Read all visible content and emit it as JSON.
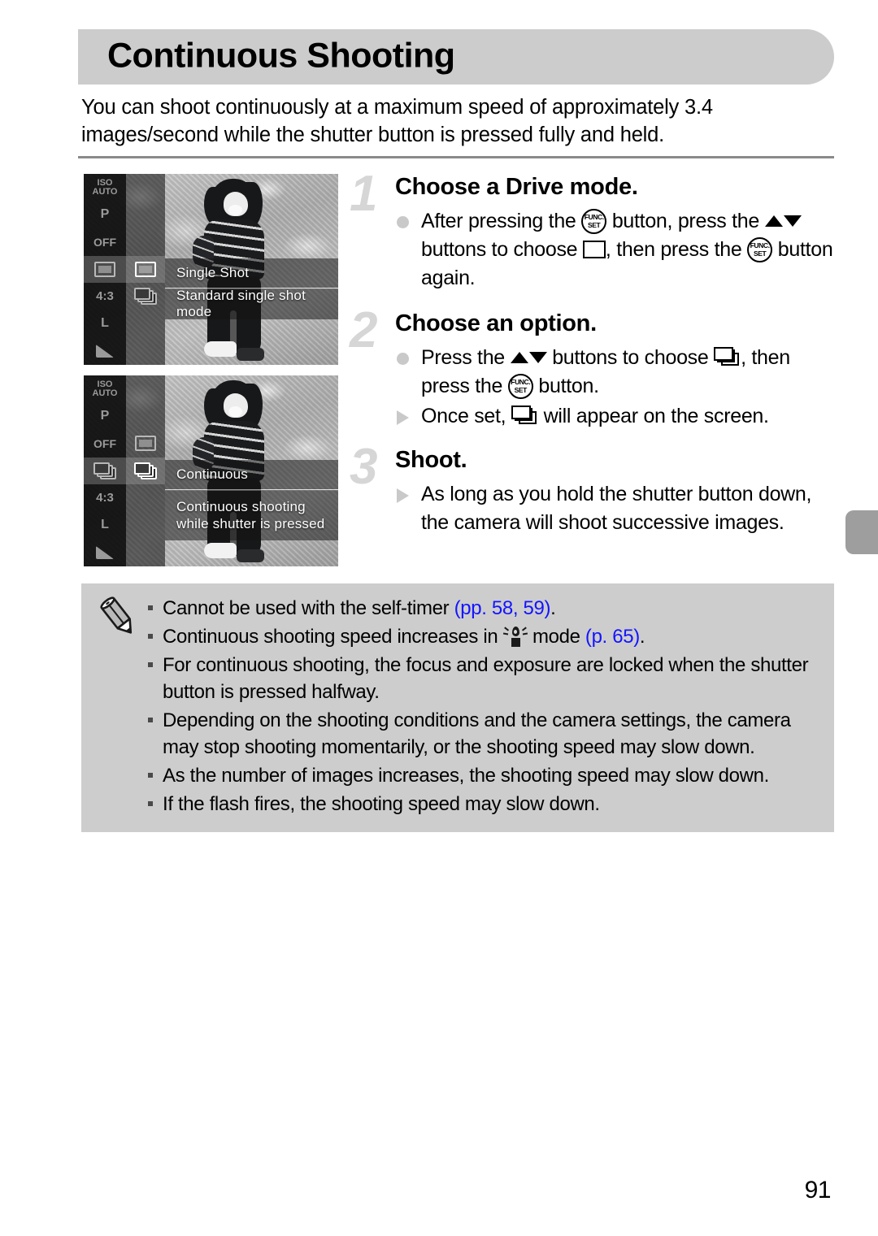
{
  "document": {
    "title": "Continuous Shooting",
    "intro": "You can shoot continuously at a maximum speed of approximately 3.4 images/second while the shutter button is pressed fully and held.",
    "page_number": "91"
  },
  "screenshots": [
    {
      "name": "single-shot-menu",
      "rail_items": [
        "ISO AUTO",
        "P",
        "OFF",
        "single-shot-icon",
        "4:3",
        "L",
        "exposure-icon"
      ],
      "selected_option_icon": "single-shot-icon",
      "other_option_icon": "continuous-icon",
      "option_title": "Single Shot",
      "option_description": "Standard single shot mode"
    },
    {
      "name": "continuous-menu",
      "rail_items": [
        "ISO AUTO",
        "P",
        "OFF",
        "continuous-icon",
        "4:3",
        "L",
        "exposure-icon"
      ],
      "selected_option_icon": "continuous-icon",
      "other_option_icon": "single-shot-icon",
      "option_title": "Continuous",
      "option_description_line1": "Continuous shooting",
      "option_description_line2": "while shutter is pressed"
    }
  ],
  "steps": [
    {
      "number": "1",
      "heading": "Choose a Drive mode.",
      "bullets": [
        {
          "marker": "dot",
          "parts": [
            {
              "type": "text",
              "value": "After pressing the "
            },
            {
              "type": "icon",
              "value": "func-set-button"
            },
            {
              "type": "text",
              "value": " button, press the "
            },
            {
              "type": "icon",
              "value": "up-down-buttons"
            },
            {
              "type": "text",
              "value": " buttons to choose "
            },
            {
              "type": "icon",
              "value": "single-shot-frame"
            },
            {
              "type": "text",
              "value": ", then press the "
            },
            {
              "type": "icon",
              "value": "func-set-button"
            },
            {
              "type": "text",
              "value": " button again."
            }
          ]
        }
      ]
    },
    {
      "number": "2",
      "heading": "Choose an option.",
      "bullets": [
        {
          "marker": "dot",
          "parts": [
            {
              "type": "text",
              "value": "Press the "
            },
            {
              "type": "icon",
              "value": "up-down-buttons"
            },
            {
              "type": "text",
              "value": " buttons to choose "
            },
            {
              "type": "icon",
              "value": "continuous-stack"
            },
            {
              "type": "text",
              "value": ", then press the "
            },
            {
              "type": "icon",
              "value": "func-set-button"
            },
            {
              "type": "text",
              "value": " button."
            }
          ]
        },
        {
          "marker": "triangle",
          "parts": [
            {
              "type": "text",
              "value": "Once set, "
            },
            {
              "type": "icon",
              "value": "continuous-stack"
            },
            {
              "type": "text",
              "value": " will appear on the screen."
            }
          ]
        }
      ]
    },
    {
      "number": "3",
      "heading": "Shoot.",
      "bullets": [
        {
          "marker": "triangle",
          "parts": [
            {
              "type": "text",
              "value": "As long as you hold the shutter button down, the camera will shoot successive images."
            }
          ]
        }
      ]
    }
  ],
  "notes": {
    "icon": "pencil-icon",
    "items": [
      {
        "id": "note-self-timer",
        "parts": [
          {
            "type": "text",
            "value": "Cannot be used with the self-timer "
          },
          {
            "type": "ref",
            "value": "(pp. 58, 59)"
          },
          {
            "type": "text",
            "value": "."
          }
        ]
      },
      {
        "id": "note-low-light",
        "parts": [
          {
            "type": "text",
            "value": "Continuous shooting speed increases in "
          },
          {
            "type": "icon",
            "value": "low-light-mode"
          },
          {
            "type": "text",
            "value": " mode "
          },
          {
            "type": "ref",
            "value": "(p. 65)"
          },
          {
            "type": "text",
            "value": "."
          }
        ]
      },
      {
        "id": "note-focus-exposure",
        "parts": [
          {
            "type": "text",
            "value": "For continuous shooting, the focus and exposure are locked when the shutter button is pressed halfway."
          }
        ]
      },
      {
        "id": "note-conditions",
        "parts": [
          {
            "type": "text",
            "value": "Depending on the shooting conditions and the camera settings, the camera may stop shooting momentarily, or the shooting speed may slow down."
          }
        ]
      },
      {
        "id": "note-image-count",
        "parts": [
          {
            "type": "text",
            "value": "As the number of images increases, the shooting speed may slow down."
          }
        ]
      },
      {
        "id": "note-flash",
        "parts": [
          {
            "type": "text",
            "value": "If the flash fires, the shooting speed may slow down."
          }
        ]
      }
    ]
  },
  "colors": {
    "title_bar": "#cccccc",
    "notes_background": "#cdcdcd",
    "page_reference": "#1414ff",
    "step_number": "#d6d6d6",
    "edge_tab": "#9e9e9e"
  }
}
